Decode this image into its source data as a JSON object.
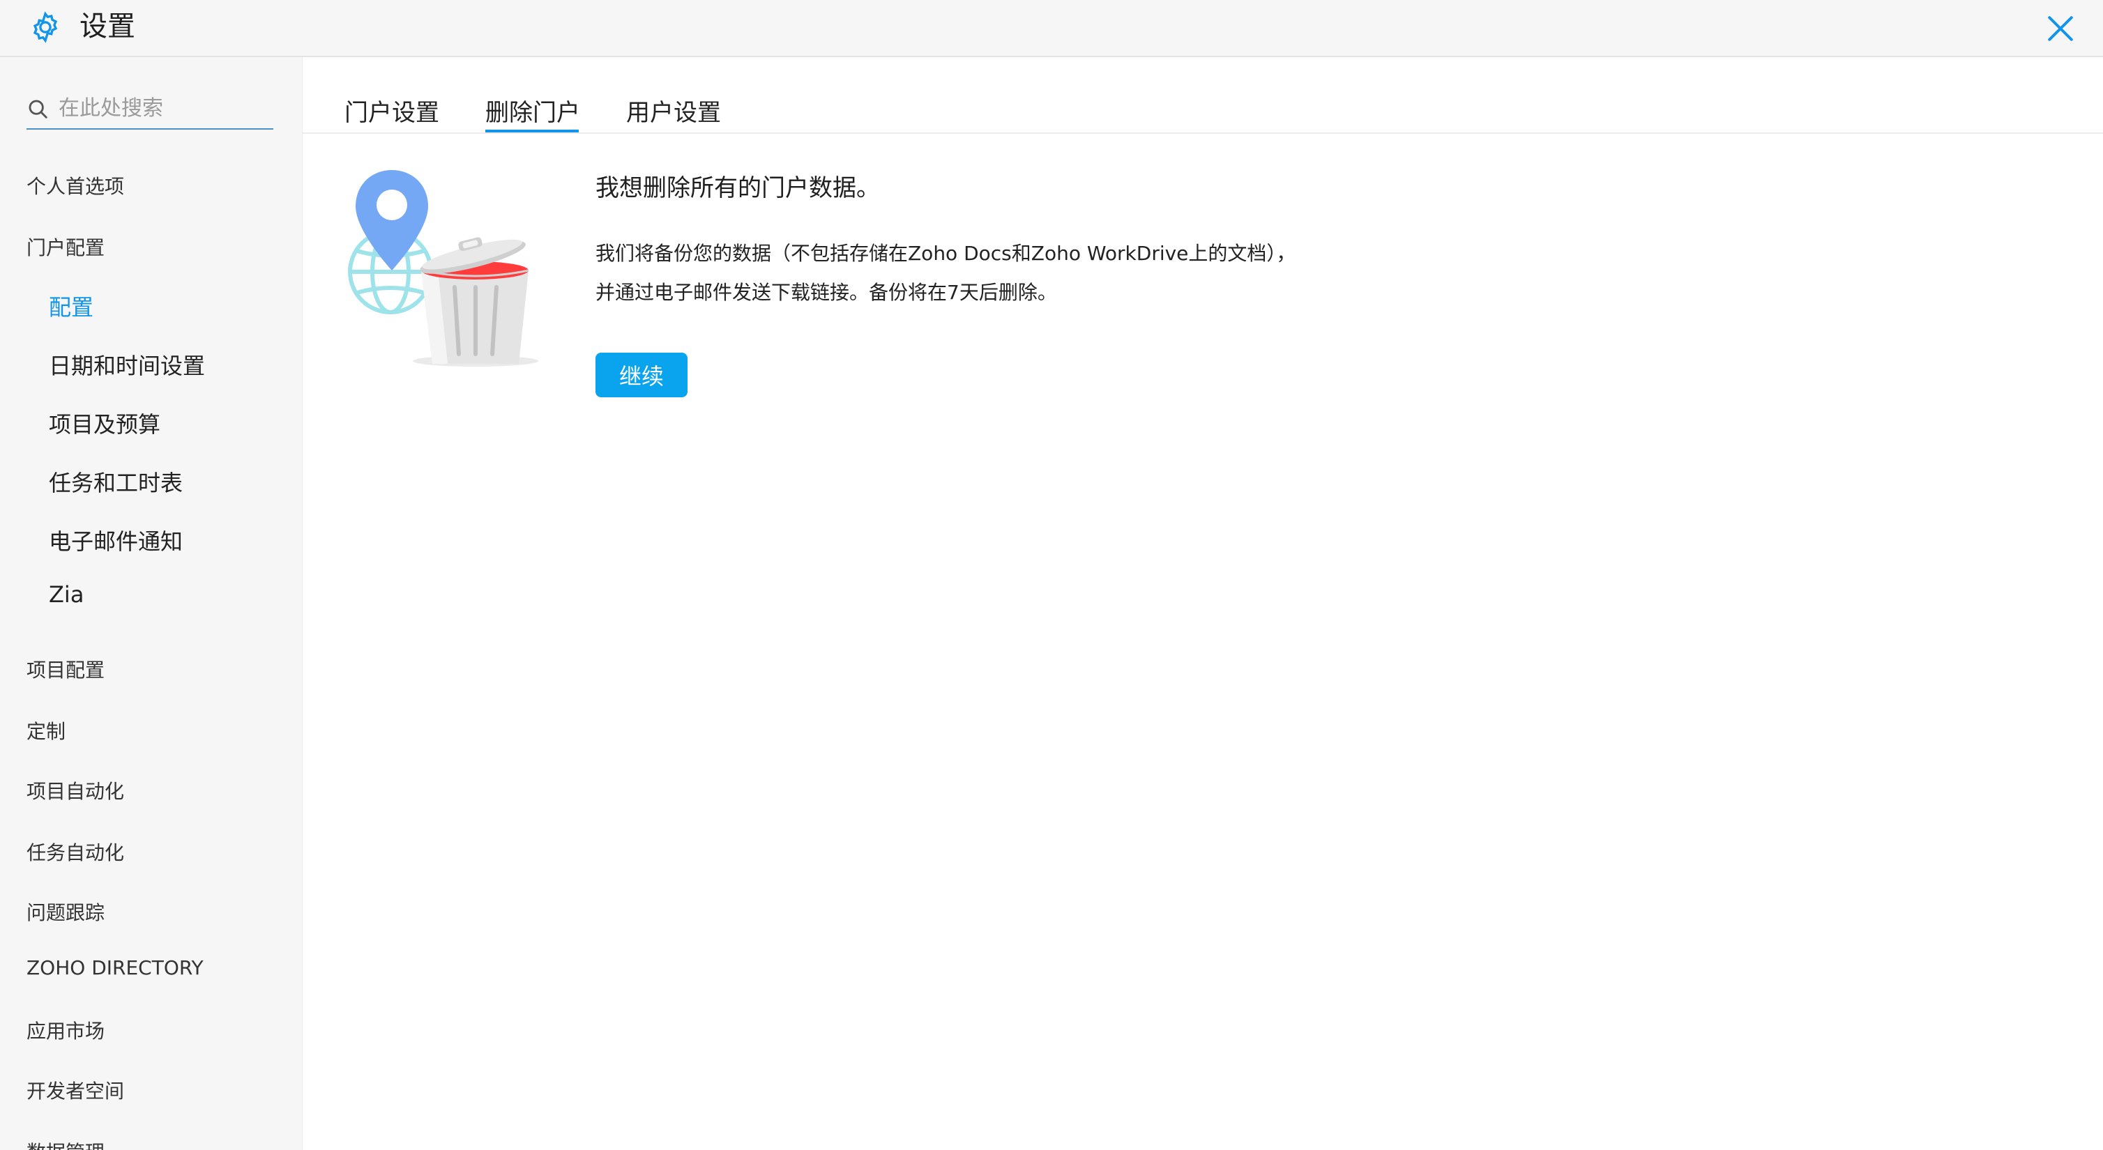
{
  "header": {
    "title": "设置",
    "icon": "gear-icon",
    "close_icon": "close-icon",
    "accent_color": "#1295e8"
  },
  "search": {
    "placeholder": "在此处搜索",
    "value": ""
  },
  "sidebar": {
    "items": [
      {
        "label": "个人首选项"
      },
      {
        "label": "门户配置"
      },
      {
        "label": "配置",
        "active": true
      },
      {
        "label": "日期和时间设置"
      },
      {
        "label": "项目及预算"
      },
      {
        "label": "任务和工时表"
      },
      {
        "label": "电子邮件通知"
      },
      {
        "label": "Zia"
      },
      {
        "label": "项目配置"
      },
      {
        "label": "定制"
      },
      {
        "label": "项目自动化"
      },
      {
        "label": "任务自动化"
      },
      {
        "label": "问题跟踪"
      },
      {
        "label": "ZOHO DIRECTORY"
      },
      {
        "label": "应用市场"
      },
      {
        "label": "开发者空间"
      },
      {
        "label": "数据管理"
      }
    ]
  },
  "tabs": [
    {
      "label": "门户设置"
    },
    {
      "label": "删除门户",
      "active": true
    },
    {
      "label": "用户设置"
    }
  ],
  "main": {
    "heading": "我想删除所有的门户数据。",
    "description": "我们将备份您的数据（不包括存储在Zoho Docs和Zoho WorkDrive上的文档），并通过电子邮件发送下载链接。备份将在7天后删除。",
    "continue_label": "继续",
    "button_color": "#0aa4ee",
    "illustration": "delete-portal-illustration"
  }
}
